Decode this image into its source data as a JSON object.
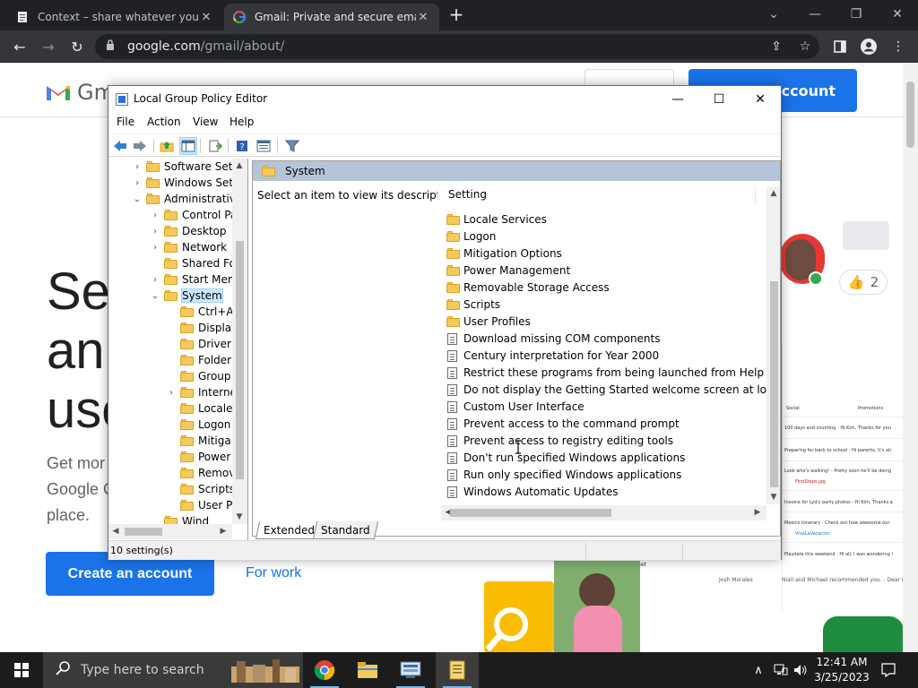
{
  "browser": {
    "tabs": [
      {
        "title": "Context – share whatever you se",
        "close": "✕"
      },
      {
        "title": "Gmail: Private and secure email a",
        "close": "✕"
      }
    ],
    "new_tab": "+",
    "url_host": "google.com",
    "url_path": "/gmail/about/"
  },
  "gmail": {
    "logo_word": "Gm",
    "hero_lines": [
      "Se",
      "an",
      "use"
    ],
    "sub_lines": [
      "Get mor",
      "Google C",
      "place."
    ],
    "create_top": "account",
    "create_button": "Create an account",
    "for_work": "For work",
    "chip_count": "2",
    "mock_rows": [
      "Social",
      "Promotions",
      "100 days and counting - Hi Kim, Thanks for you",
      "Preparing for back to school - Hi parents, It's alr",
      "Look who's walking! - Pretty soon he'll be doing",
      "FirstSteps.jpg",
      "Invoice for Lyd's party photos - Hi Kim, Thanks a",
      "Mexico itinerary - Check out how awesome our",
      "VivaLaVacacion",
      "Playdate this weekend - Hi all, I was wondering i",
      "Meet",
      "Josh Morales",
      "Niall and Michael recommended you. - Dear Kim"
    ]
  },
  "gpe": {
    "title": "Local Group Policy Editor",
    "menu": [
      "File",
      "Action",
      "View",
      "Help"
    ],
    "tree": [
      {
        "label": "Software Setti",
        "level": 1,
        "arrow": "›"
      },
      {
        "label": "Windows Setti",
        "level": 1,
        "arrow": "›"
      },
      {
        "label": "Administrative",
        "level": 1,
        "arrow": "⌄"
      },
      {
        "label": "Control Pa",
        "level": 2,
        "arrow": "›"
      },
      {
        "label": "Desktop",
        "level": 2,
        "arrow": "›"
      },
      {
        "label": "Network",
        "level": 2,
        "arrow": "›"
      },
      {
        "label": "Shared Fol",
        "level": 2,
        "arrow": ""
      },
      {
        "label": "Start Menu",
        "level": 2,
        "arrow": "›"
      },
      {
        "label": "System",
        "level": 2,
        "arrow": "⌄",
        "selected": true
      },
      {
        "label": "Ctrl+A",
        "level": 3,
        "arrow": ""
      },
      {
        "label": "Display",
        "level": 3,
        "arrow": ""
      },
      {
        "label": "Driver",
        "level": 3,
        "arrow": ""
      },
      {
        "label": "Folder",
        "level": 3,
        "arrow": ""
      },
      {
        "label": "Group",
        "level": 3,
        "arrow": ""
      },
      {
        "label": "Interne",
        "level": 3,
        "arrow": "›"
      },
      {
        "label": "Locale",
        "level": 3,
        "arrow": ""
      },
      {
        "label": "Logon",
        "level": 3,
        "arrow": ""
      },
      {
        "label": "Mitiga",
        "level": 3,
        "arrow": ""
      },
      {
        "label": "Power",
        "level": 3,
        "arrow": ""
      },
      {
        "label": "Remov",
        "level": 3,
        "arrow": ""
      },
      {
        "label": "Scripts",
        "level": 3,
        "arrow": ""
      },
      {
        "label": "User Pr",
        "level": 3,
        "arrow": ""
      },
      {
        "label": "Wind",
        "level": 2,
        "arrow": ""
      }
    ],
    "header": "System",
    "description": "Select an item to view its description.",
    "column": "Setting",
    "items": [
      {
        "label": "Locale Services",
        "type": "folder"
      },
      {
        "label": "Logon",
        "type": "folder"
      },
      {
        "label": "Mitigation Options",
        "type": "folder"
      },
      {
        "label": "Power Management",
        "type": "folder"
      },
      {
        "label": "Removable Storage Access",
        "type": "folder"
      },
      {
        "label": "Scripts",
        "type": "folder"
      },
      {
        "label": "User Profiles",
        "type": "folder"
      },
      {
        "label": "Download missing COM components",
        "type": "setting"
      },
      {
        "label": "Century interpretation for Year 2000",
        "type": "setting"
      },
      {
        "label": "Restrict these programs from being launched from Help",
        "type": "setting"
      },
      {
        "label": "Do not display the Getting Started welcome screen at logon",
        "type": "setting"
      },
      {
        "label": "Custom User Interface",
        "type": "setting"
      },
      {
        "label": "Prevent access to the command prompt",
        "type": "setting"
      },
      {
        "label": "Prevent access to registry editing tools",
        "type": "setting"
      },
      {
        "label": "Don't run specified Windows applications",
        "type": "setting"
      },
      {
        "label": "Run only specified Windows applications",
        "type": "setting"
      },
      {
        "label": "Windows Automatic Updates",
        "type": "setting"
      }
    ],
    "tabs": [
      "Extended",
      "Standard"
    ],
    "status": "10 setting(s)"
  },
  "taskbar": {
    "search_placeholder": "Type here to search",
    "time": "12:41 AM",
    "date": "3/25/2023"
  },
  "colors": {
    "accent_blue": "#1a73e8",
    "header_blue": "#b5c4d9",
    "folder_yellow": "#f4c95d",
    "taskbar": "#1c1c1c"
  }
}
